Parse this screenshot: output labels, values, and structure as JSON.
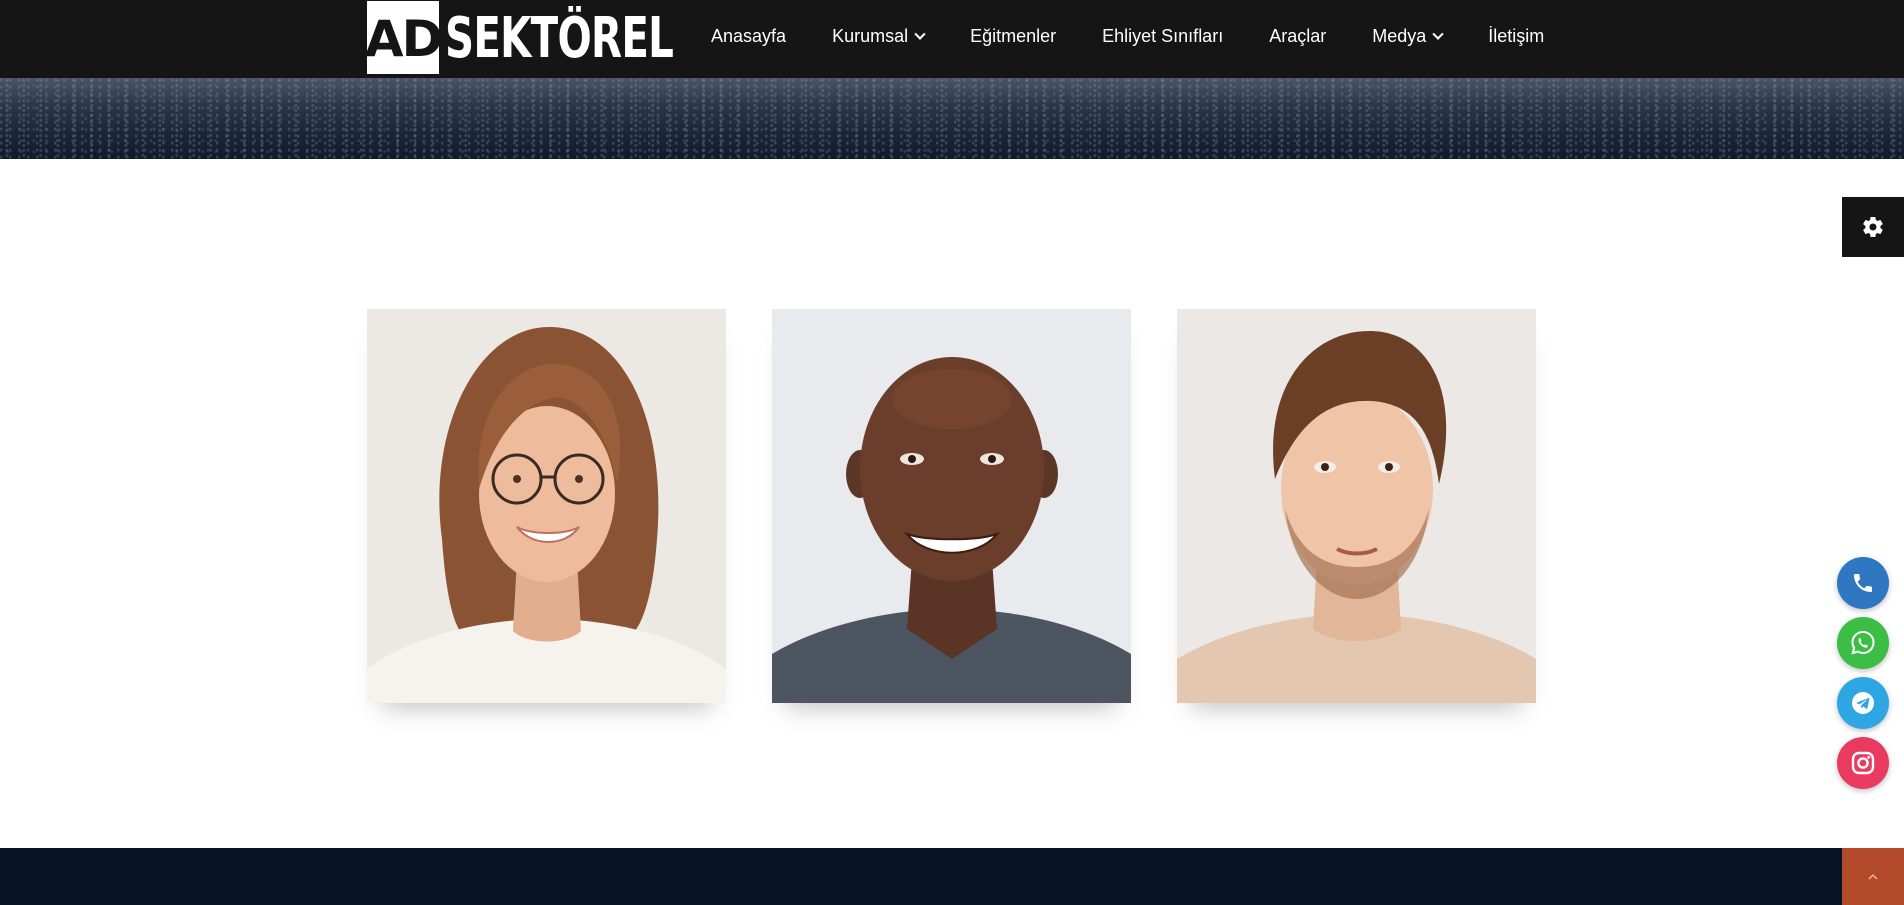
{
  "header": {
    "logo": {
      "badge_text": "AD",
      "wordmark": "SEKTÖREL"
    },
    "nav": [
      {
        "label": "Anasayfa",
        "has_dropdown": false
      },
      {
        "label": "Kurumsal",
        "has_dropdown": true
      },
      {
        "label": "Eğitmenler",
        "has_dropdown": false
      },
      {
        "label": "Ehliyet Sınıfları",
        "has_dropdown": false
      },
      {
        "label": "Araçlar",
        "has_dropdown": false
      },
      {
        "label": "Medya",
        "has_dropdown": true
      },
      {
        "label": "İletişim",
        "has_dropdown": false
      }
    ]
  },
  "floating_buttons": [
    {
      "icon": "phone-icon",
      "color": "#2f77c0"
    },
    {
      "icon": "whatsapp-icon",
      "color": "#3cbd45"
    },
    {
      "icon": "telegram-icon",
      "color": "#2ea6e3"
    },
    {
      "icon": "instagram-icon",
      "color": "#e93a5f"
    }
  ],
  "settings_icon": "gear-icon",
  "scroll_top_icon": "chevron-up-icon",
  "colors": {
    "header_bg": "#151515",
    "footer_bg": "#071326",
    "scroll_top_bg": "#b34a2b"
  }
}
